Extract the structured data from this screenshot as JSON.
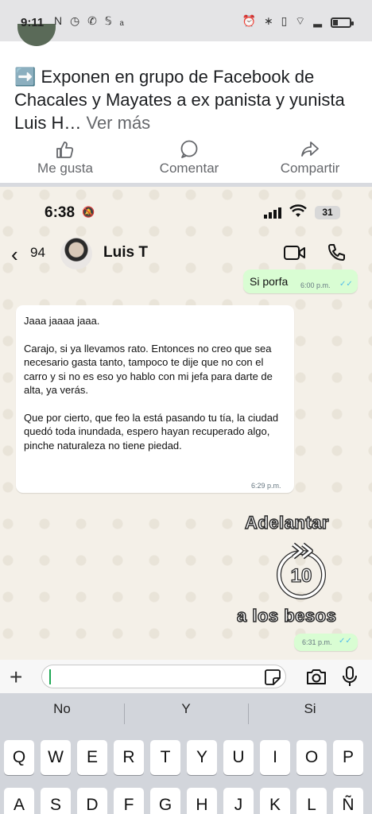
{
  "status_bar": {
    "time": "9:11",
    "app_icons": "N ◷ ✆ 𝕊 ₐ",
    "system_icons": "⏰ ∗ ▯ ⌔ ▂"
  },
  "post": {
    "text": "➡️ Exponen en grupo de Facebook de Chacales y Mayates a ex panista y yunista Luis H…",
    "see_more": "Ver más",
    "actions": {
      "like": "Me gusta",
      "comment": "Comentar",
      "share": "Compartir"
    }
  },
  "chat_screenshot": {
    "ios_time": "6:38",
    "battery": "31",
    "back_count": "94",
    "contact_name": "Luis T",
    "messages": [
      {
        "direction": "out",
        "text": "Si porfa",
        "time": "6:00 p.m."
      },
      {
        "direction": "in",
        "paragraphs": [
          "Jaaa jaaaa jaaa.",
          "Carajo, si ya llevamos rato. Entonces no creo que sea necesario gasta tanto, tampoco te dije que no con el carro y si no es eso yo hablo con mi jefa para darte de alta, ya verás.",
          "Que por cierto, que feo la está pasando tu tía, la ciudad quedó toda inundada, espero hayan recuperado algo, pinche naturaleza no tiene piedad."
        ],
        "time": "6:29 p.m."
      },
      {
        "direction": "out",
        "text": "",
        "time": "6:31 p.m."
      }
    ],
    "overlay": {
      "top": "Adelantar",
      "number": "10",
      "bottom": "a los besos"
    },
    "keyboard": {
      "suggestions": [
        "No",
        "Y",
        "Si"
      ],
      "row1": [
        "Q",
        "W",
        "E",
        "R",
        "T",
        "Y",
        "U",
        "I",
        "O",
        "P"
      ],
      "row2": [
        "A",
        "S",
        "D",
        "F",
        "G",
        "H",
        "J",
        "K",
        "L",
        "Ñ"
      ]
    }
  }
}
